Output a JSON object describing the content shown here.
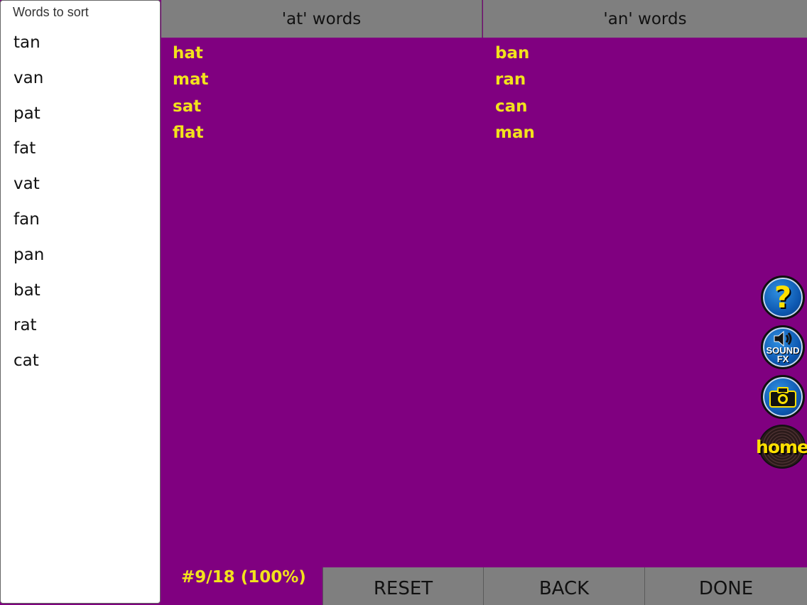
{
  "sidebar": {
    "title": "Words to sort",
    "words": [
      "tan",
      "van",
      "pat",
      "fat",
      "vat",
      "fan",
      "pan",
      "bat",
      "rat",
      "cat"
    ]
  },
  "columns": [
    {
      "header": "'at' words",
      "words": [
        "hat",
        "mat",
        "sat",
        "flat"
      ]
    },
    {
      "header": "'an' words",
      "words": [
        "ban",
        "ran",
        "can",
        "man"
      ]
    }
  ],
  "tools": {
    "help_icon": "question-mark-icon",
    "sound_label_line1": "SOUND",
    "sound_label_line2": "FX",
    "camera_icon": "camera-icon",
    "home_label": "home"
  },
  "footer": {
    "progress": "#9/18 (100%)",
    "reset_label": "RESET",
    "back_label": "BACK",
    "done_label": "DONE"
  },
  "colors": {
    "background": "#800080",
    "accent_text": "#f2e21c",
    "header_bg": "#7f7f7f"
  }
}
